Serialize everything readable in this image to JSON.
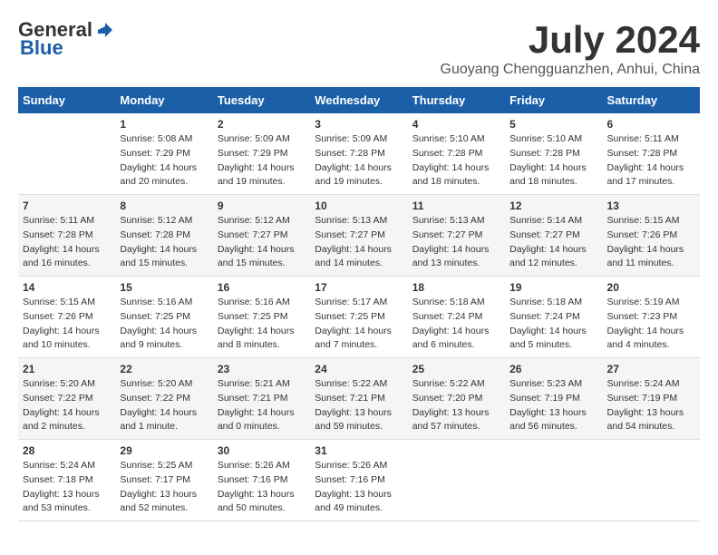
{
  "logo": {
    "general": "General",
    "blue": "Blue"
  },
  "title": "July 2024",
  "subtitle": "Guoyang Chengguanzhen, Anhui, China",
  "days_header": [
    "Sunday",
    "Monday",
    "Tuesday",
    "Wednesday",
    "Thursday",
    "Friday",
    "Saturday"
  ],
  "weeks": [
    [
      {
        "day": "",
        "info": ""
      },
      {
        "day": "1",
        "info": "Sunrise: 5:08 AM\nSunset: 7:29 PM\nDaylight: 14 hours\nand 20 minutes."
      },
      {
        "day": "2",
        "info": "Sunrise: 5:09 AM\nSunset: 7:29 PM\nDaylight: 14 hours\nand 19 minutes."
      },
      {
        "day": "3",
        "info": "Sunrise: 5:09 AM\nSunset: 7:28 PM\nDaylight: 14 hours\nand 19 minutes."
      },
      {
        "day": "4",
        "info": "Sunrise: 5:10 AM\nSunset: 7:28 PM\nDaylight: 14 hours\nand 18 minutes."
      },
      {
        "day": "5",
        "info": "Sunrise: 5:10 AM\nSunset: 7:28 PM\nDaylight: 14 hours\nand 18 minutes."
      },
      {
        "day": "6",
        "info": "Sunrise: 5:11 AM\nSunset: 7:28 PM\nDaylight: 14 hours\nand 17 minutes."
      }
    ],
    [
      {
        "day": "7",
        "info": "Sunrise: 5:11 AM\nSunset: 7:28 PM\nDaylight: 14 hours\nand 16 minutes."
      },
      {
        "day": "8",
        "info": "Sunrise: 5:12 AM\nSunset: 7:28 PM\nDaylight: 14 hours\nand 15 minutes."
      },
      {
        "day": "9",
        "info": "Sunrise: 5:12 AM\nSunset: 7:27 PM\nDaylight: 14 hours\nand 15 minutes."
      },
      {
        "day": "10",
        "info": "Sunrise: 5:13 AM\nSunset: 7:27 PM\nDaylight: 14 hours\nand 14 minutes."
      },
      {
        "day": "11",
        "info": "Sunrise: 5:13 AM\nSunset: 7:27 PM\nDaylight: 14 hours\nand 13 minutes."
      },
      {
        "day": "12",
        "info": "Sunrise: 5:14 AM\nSunset: 7:27 PM\nDaylight: 14 hours\nand 12 minutes."
      },
      {
        "day": "13",
        "info": "Sunrise: 5:15 AM\nSunset: 7:26 PM\nDaylight: 14 hours\nand 11 minutes."
      }
    ],
    [
      {
        "day": "14",
        "info": "Sunrise: 5:15 AM\nSunset: 7:26 PM\nDaylight: 14 hours\nand 10 minutes."
      },
      {
        "day": "15",
        "info": "Sunrise: 5:16 AM\nSunset: 7:25 PM\nDaylight: 14 hours\nand 9 minutes."
      },
      {
        "day": "16",
        "info": "Sunrise: 5:16 AM\nSunset: 7:25 PM\nDaylight: 14 hours\nand 8 minutes."
      },
      {
        "day": "17",
        "info": "Sunrise: 5:17 AM\nSunset: 7:25 PM\nDaylight: 14 hours\nand 7 minutes."
      },
      {
        "day": "18",
        "info": "Sunrise: 5:18 AM\nSunset: 7:24 PM\nDaylight: 14 hours\nand 6 minutes."
      },
      {
        "day": "19",
        "info": "Sunrise: 5:18 AM\nSunset: 7:24 PM\nDaylight: 14 hours\nand 5 minutes."
      },
      {
        "day": "20",
        "info": "Sunrise: 5:19 AM\nSunset: 7:23 PM\nDaylight: 14 hours\nand 4 minutes."
      }
    ],
    [
      {
        "day": "21",
        "info": "Sunrise: 5:20 AM\nSunset: 7:22 PM\nDaylight: 14 hours\nand 2 minutes."
      },
      {
        "day": "22",
        "info": "Sunrise: 5:20 AM\nSunset: 7:22 PM\nDaylight: 14 hours\nand 1 minute."
      },
      {
        "day": "23",
        "info": "Sunrise: 5:21 AM\nSunset: 7:21 PM\nDaylight: 14 hours\nand 0 minutes."
      },
      {
        "day": "24",
        "info": "Sunrise: 5:22 AM\nSunset: 7:21 PM\nDaylight: 13 hours\nand 59 minutes."
      },
      {
        "day": "25",
        "info": "Sunrise: 5:22 AM\nSunset: 7:20 PM\nDaylight: 13 hours\nand 57 minutes."
      },
      {
        "day": "26",
        "info": "Sunrise: 5:23 AM\nSunset: 7:19 PM\nDaylight: 13 hours\nand 56 minutes."
      },
      {
        "day": "27",
        "info": "Sunrise: 5:24 AM\nSunset: 7:19 PM\nDaylight: 13 hours\nand 54 minutes."
      }
    ],
    [
      {
        "day": "28",
        "info": "Sunrise: 5:24 AM\nSunset: 7:18 PM\nDaylight: 13 hours\nand 53 minutes."
      },
      {
        "day": "29",
        "info": "Sunrise: 5:25 AM\nSunset: 7:17 PM\nDaylight: 13 hours\nand 52 minutes."
      },
      {
        "day": "30",
        "info": "Sunrise: 5:26 AM\nSunset: 7:16 PM\nDaylight: 13 hours\nand 50 minutes."
      },
      {
        "day": "31",
        "info": "Sunrise: 5:26 AM\nSunset: 7:16 PM\nDaylight: 13 hours\nand 49 minutes."
      },
      {
        "day": "",
        "info": ""
      },
      {
        "day": "",
        "info": ""
      },
      {
        "day": "",
        "info": ""
      }
    ]
  ]
}
